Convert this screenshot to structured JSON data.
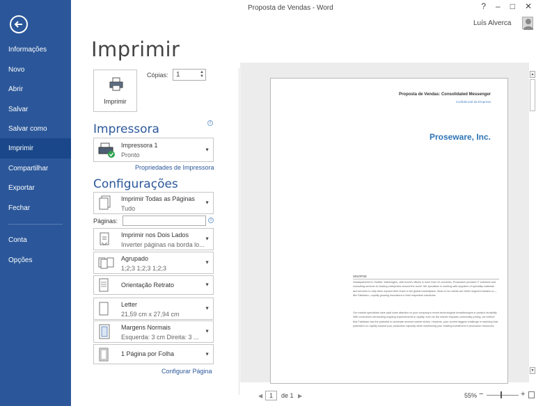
{
  "window": {
    "title": "Proposta de Vendas - Word",
    "controls": [
      "?",
      "–",
      "□",
      "✕"
    ],
    "user_name": "Luís Alverca"
  },
  "sidebar": {
    "items": [
      {
        "label": "Informações"
      },
      {
        "label": "Novo"
      },
      {
        "label": "Abrir"
      },
      {
        "label": "Salvar"
      },
      {
        "label": "Salvar como"
      },
      {
        "label": "Imprimir",
        "active": true
      },
      {
        "label": "Compartilhar"
      },
      {
        "label": "Exportar"
      },
      {
        "label": "Fechar"
      },
      {
        "label": "Conta"
      },
      {
        "label": "Opções"
      }
    ]
  },
  "page": {
    "heading": "Imprimir"
  },
  "print": {
    "button_label": "Imprimir",
    "copies_label": "Cópias:",
    "copies_value": "1"
  },
  "printer": {
    "heading": "Impressora",
    "name": "Impressora 1",
    "status": "Pronto",
    "properties_link": "Propriedades de Impressora"
  },
  "settings": {
    "heading": "Configurações",
    "pages_label": "Páginas:",
    "print_range": {
      "line1": "Imprimir Todas as Páginas",
      "line2": "Tudo"
    },
    "sides": {
      "line1": "Imprimir nos Dois Lados",
      "line2": "Inverter páginas na borda lo..."
    },
    "collation": {
      "line1": "Agrupado",
      "line2": "1;2;3   1;2;3   1;2;3"
    },
    "orientation": {
      "line1": "Orientação Retrato"
    },
    "paper": {
      "line1": "Letter",
      "line2": "21,59 cm x 27,94 cm"
    },
    "margins": {
      "line1": "Margens Normais",
      "line2": "Esquerda: 3 cm   Direita: 3 ..."
    },
    "per_sheet": {
      "line1": "1 Página por Folha"
    },
    "page_setup_link": "Configurar Página"
  },
  "preview": {
    "header_title": "Proposta de Vendas: Consolidated Messenger",
    "header_sub": "Confidencial da Empresa",
    "company": "Proseware, Inc.",
    "sinopse_label": "SINOPSE",
    "para1": "Headquartered in Seattle, Washington, with branch offices in more than 10 countries, Proseware provides IT solutions and consulting services to leading enterprises around the world. We specialize in working with suppliers of specialty materials and services to help them expand their reach in the global marketplace. Most of our clients are either segment leaders or—like Fabrikam—rapidly growing innovators in their respective industries.",
    "para2": "Our market specialists have paid close attention to your company's recent technological breakthroughs in product durability. With consumers demanding ongoing improvements in quality, even as the market imposes commodity pricing, we believe that Fabrikam has the potential to dominate several market niches. However, your current biggest challenge in reaching that potential is to rapidly expand your production capacity while maximizing your existing investment in production resources."
  },
  "footer": {
    "current_page": "1",
    "page_of": "de 1",
    "zoom": "55%",
    "zoom_level_percent": 55
  }
}
